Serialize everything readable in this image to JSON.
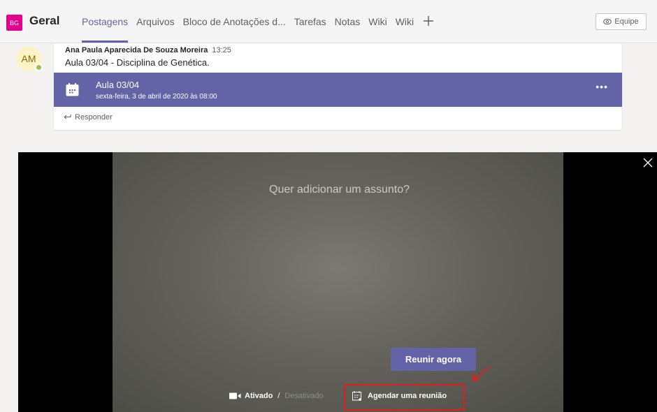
{
  "header": {
    "team_initials": "BG",
    "channel_name": "Geral",
    "tabs": [
      {
        "label": "Postagens",
        "active": true
      },
      {
        "label": "Arquivos"
      },
      {
        "label": "Bloco de Anotações d..."
      },
      {
        "label": "Tarefas"
      },
      {
        "label": "Notas"
      },
      {
        "label": "Wiki"
      },
      {
        "label": "Wiki"
      }
    ],
    "add_tab_icon": "plus-icon",
    "team_button_label": "Equipe",
    "accent_color": "#6264a7",
    "team_color": "#e3008c"
  },
  "post": {
    "avatar_initials": "AM",
    "author": "Ana Paula Aparecida De Souza Moreira",
    "time": "13:25",
    "text": "Aula 03/04 - Disciplina de Genética.",
    "meeting": {
      "title": "Aula 03/04",
      "date": "sexta-feira, 3 de abril de 2020 às 08:00",
      "more_label": "•••"
    },
    "reply_label": "Responder"
  },
  "meeting_preview": {
    "subject_placeholder": "Quer adicionar um assunto?",
    "join_label": "Reunir agora",
    "camera_on_label": "Ativado",
    "separator": "/",
    "camera_off_label": "Desativado",
    "schedule_label": "Agendar uma reunião",
    "highlight_color": "#e01e1e"
  }
}
